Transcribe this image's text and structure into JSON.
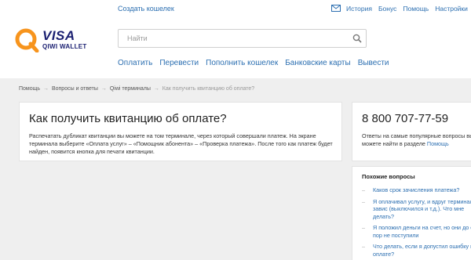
{
  "header": {
    "create_wallet": "Создать кошелек",
    "top_links": [
      "История",
      "Бонус",
      "Помощь",
      "Настройки"
    ],
    "logo": {
      "visa": "VISA",
      "qiwi": "QIWI WALLET"
    },
    "search": {
      "placeholder": "Найти"
    },
    "nav": [
      "Оплатить",
      "Перевести",
      "Пополнить кошелек",
      "Банковские карты",
      "Вывести"
    ]
  },
  "breadcrumb": {
    "items": [
      "Помощь",
      "Вопросы и ответы",
      "Qiwi терминалы"
    ],
    "separator": "→",
    "current": "Как получить квитанцию об оплате?"
  },
  "article": {
    "title": "Как получить квитанцию об оплате?",
    "body": "Распечатать дубликат квитанции вы можете на том терминале, через который совершали платеж. На экране терминала выберите «Оплата услуг» – «Помощник абонента» – «Проверка платежа». После того как платеж будет найден, появится кнопка для печати квитанции."
  },
  "support": {
    "phone": "8 800 707-77-59",
    "note_prefix": "Ответы на самые популярные вопросы вы можете найти в разделе ",
    "note_link": "Помощь"
  },
  "related": {
    "title": "Похожие вопросы",
    "items": [
      "Каков срок зачисления платежа?",
      "Я оплачивал услугу, и вдруг терминал завис (выключился и т.д.). Что мне делать?",
      "Я положил деньги на счет, но они до сих пор не поступили",
      "Что делать, если я допустил ошибку при оплате?"
    ]
  },
  "colors": {
    "link": "#2c6fb1",
    "logo_orange": "#f7941d",
    "logo_navy": "#1a1f71",
    "page_bg": "#efefef"
  },
  "icons": {
    "mail": "mail-icon",
    "search": "search-icon"
  }
}
